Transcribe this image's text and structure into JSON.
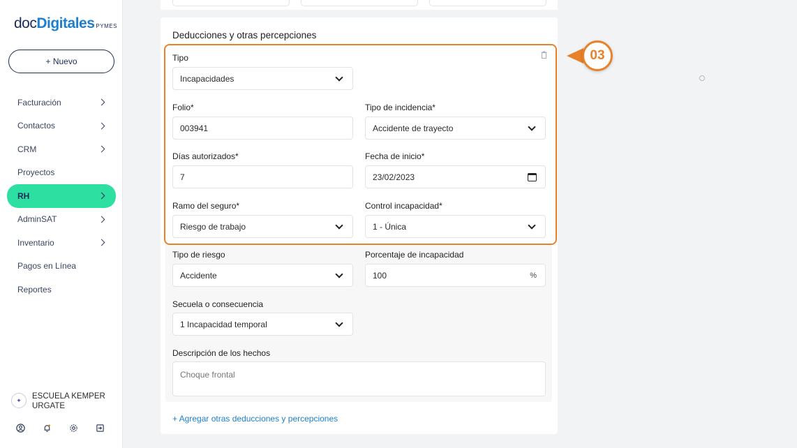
{
  "logo": {
    "doc": "doc",
    "digitales": "Digitales",
    "pymes": "PYMES"
  },
  "new_button": "+ Nuevo",
  "sidebar": {
    "items": [
      {
        "label": "Facturación",
        "chevron": true
      },
      {
        "label": "Contactos",
        "chevron": true
      },
      {
        "label": "CRM",
        "chevron": true
      },
      {
        "label": "Proyectos",
        "chevron": false
      },
      {
        "label": "RH",
        "chevron": true,
        "active": true
      },
      {
        "label": "AdminSAT",
        "chevron": true
      },
      {
        "label": "Inventario",
        "chevron": true
      },
      {
        "label": "Pagos en Línea",
        "chevron": false
      },
      {
        "label": "Reportes",
        "chevron": false
      }
    ],
    "user": {
      "line1": "ESCUELA KEMPER",
      "line2": "URGATE"
    },
    "bottom_icons": [
      "user-circle-icon",
      "bell-icon",
      "gear-icon",
      "logout-icon"
    ]
  },
  "section_title": "Deducciones y otras percepciones",
  "form": {
    "tipo": {
      "label": "Tipo",
      "value": "Incapacidades"
    },
    "folio": {
      "label": "Folio*",
      "value": "003941"
    },
    "tipo_incidencia": {
      "label": "Tipo de incidencia*",
      "value": "Accidente de trayecto"
    },
    "dias": {
      "label": "Días autorizados*",
      "value": "7"
    },
    "fecha": {
      "label": "Fecha de inicio*",
      "value": "23/02/2023"
    },
    "ramo": {
      "label": "Ramo del seguro*",
      "value": "Riesgo de trabajo"
    },
    "control": {
      "label": "Control incapacidad*",
      "value": "1 - Única"
    },
    "tipo_riesgo": {
      "label": "Tipo de riesgo",
      "value": "Accidente"
    },
    "porcentaje": {
      "label": "Porcentaje de incapacidad",
      "value": "100",
      "suffix": "%"
    },
    "secuela": {
      "label": "Secuela o consecuencia",
      "value": "1 Incapacidad temporal"
    },
    "descripcion": {
      "label": "Descripción de los hechos",
      "value": "Choque frontal"
    }
  },
  "add_link": "+ Agregar otras deducciones y percepciones",
  "step_badge": "03",
  "colors": {
    "accent_green": "#2de0a2",
    "highlight_orange": "#e8822a",
    "link_blue": "#1e7fd1",
    "navy": "#1d2c5b"
  }
}
